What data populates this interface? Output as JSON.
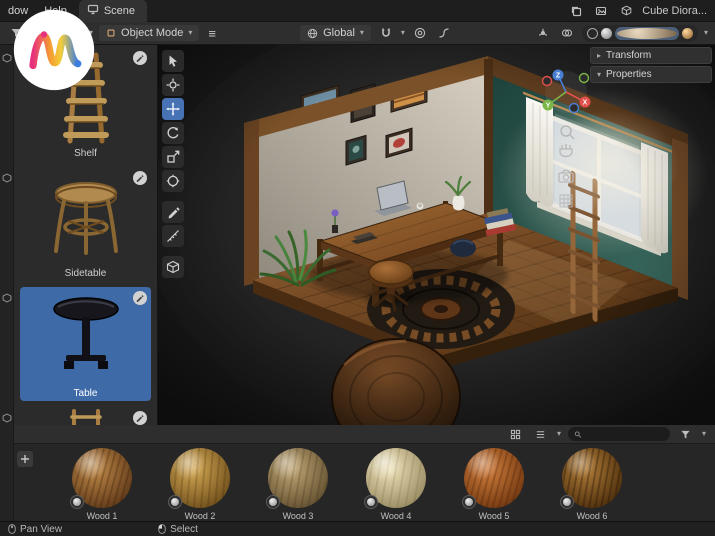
{
  "topbar": {
    "menu_window": "dow",
    "menu_help": "Help",
    "scene_tab_label": "Scene",
    "scene_name": "Cube Diora..."
  },
  "tool_header": {
    "mode_label": "Object Mode",
    "orientation_label": "Global"
  },
  "npanel": {
    "transform_label": "Transform",
    "properties_label": "Properties"
  },
  "viewport": {
    "axis_x": "X",
    "axis_y": "Y",
    "axis_z": "Z"
  },
  "sidebar": {
    "items": [
      {
        "label": "Shelf",
        "selected": false
      },
      {
        "label": "Sidetable",
        "selected": false
      },
      {
        "label": "Table",
        "selected": true
      },
      {
        "label": "",
        "selected": false
      }
    ]
  },
  "materials": {
    "search_value": "",
    "items": [
      {
        "label": "Wood 1"
      },
      {
        "label": "Wood 2"
      },
      {
        "label": "Wood 3"
      },
      {
        "label": "Wood 4"
      },
      {
        "label": "Wood 5"
      },
      {
        "label": "Wood 6"
      }
    ]
  },
  "statusbar": {
    "pan_label": "Pan View",
    "select_label": "Select"
  },
  "colors": {
    "accent": "#4772b3",
    "selection_blue": "#3f6aa8",
    "wall_teal": "#2c5850",
    "viewport_bg": "#1c1c1c"
  }
}
